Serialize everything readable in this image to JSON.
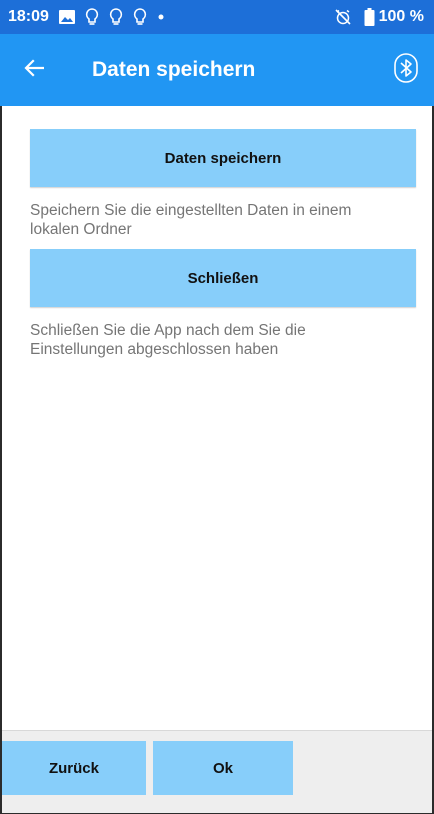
{
  "status_bar": {
    "time": "18:09",
    "battery": "100 %",
    "left_icons": [
      "image-icon",
      "lightbulb-icon",
      "lightbulb-icon",
      "lightbulb-icon",
      "dot-icon"
    ],
    "right_icons": [
      "alarm-off-icon",
      "battery-icon"
    ],
    "background": "#1d6fd8"
  },
  "toolbar": {
    "title": "Daten speichern",
    "background": "#2196f3",
    "back_icon": "arrow-left-icon",
    "bluetooth_icon": "bluetooth-icon"
  },
  "actions": [
    {
      "label": "Daten speichern",
      "description": "Speichern Sie die eingestellten Daten in einem lokalen Ordner"
    },
    {
      "label": "Schließen",
      "description": "Schließen Sie die App nach dem Sie die Einstellungen abgeschlossen haben"
    }
  ],
  "bottom": {
    "back_label": "Zurück",
    "ok_label": "Ok"
  },
  "colors": {
    "button": "#87cefa",
    "description_text": "#757575",
    "bottom_bar": "#eeeeee"
  }
}
